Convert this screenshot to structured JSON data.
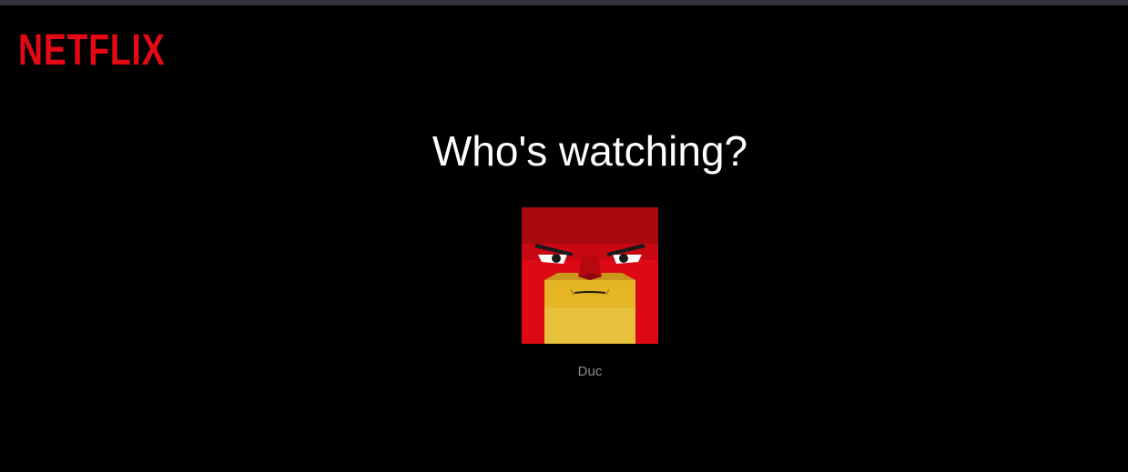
{
  "brand": {
    "logo_text": "NETFLIX",
    "color": "#e50914"
  },
  "heading": "Who's watching?",
  "profiles": [
    {
      "name": "Duc",
      "avatar_icon": "red-hooded-hero-avatar-icon"
    }
  ],
  "colors": {
    "background": "#000000",
    "top_strip": "#33343d",
    "heading": "#ffffff",
    "profile_name": "#8c8c8c"
  }
}
